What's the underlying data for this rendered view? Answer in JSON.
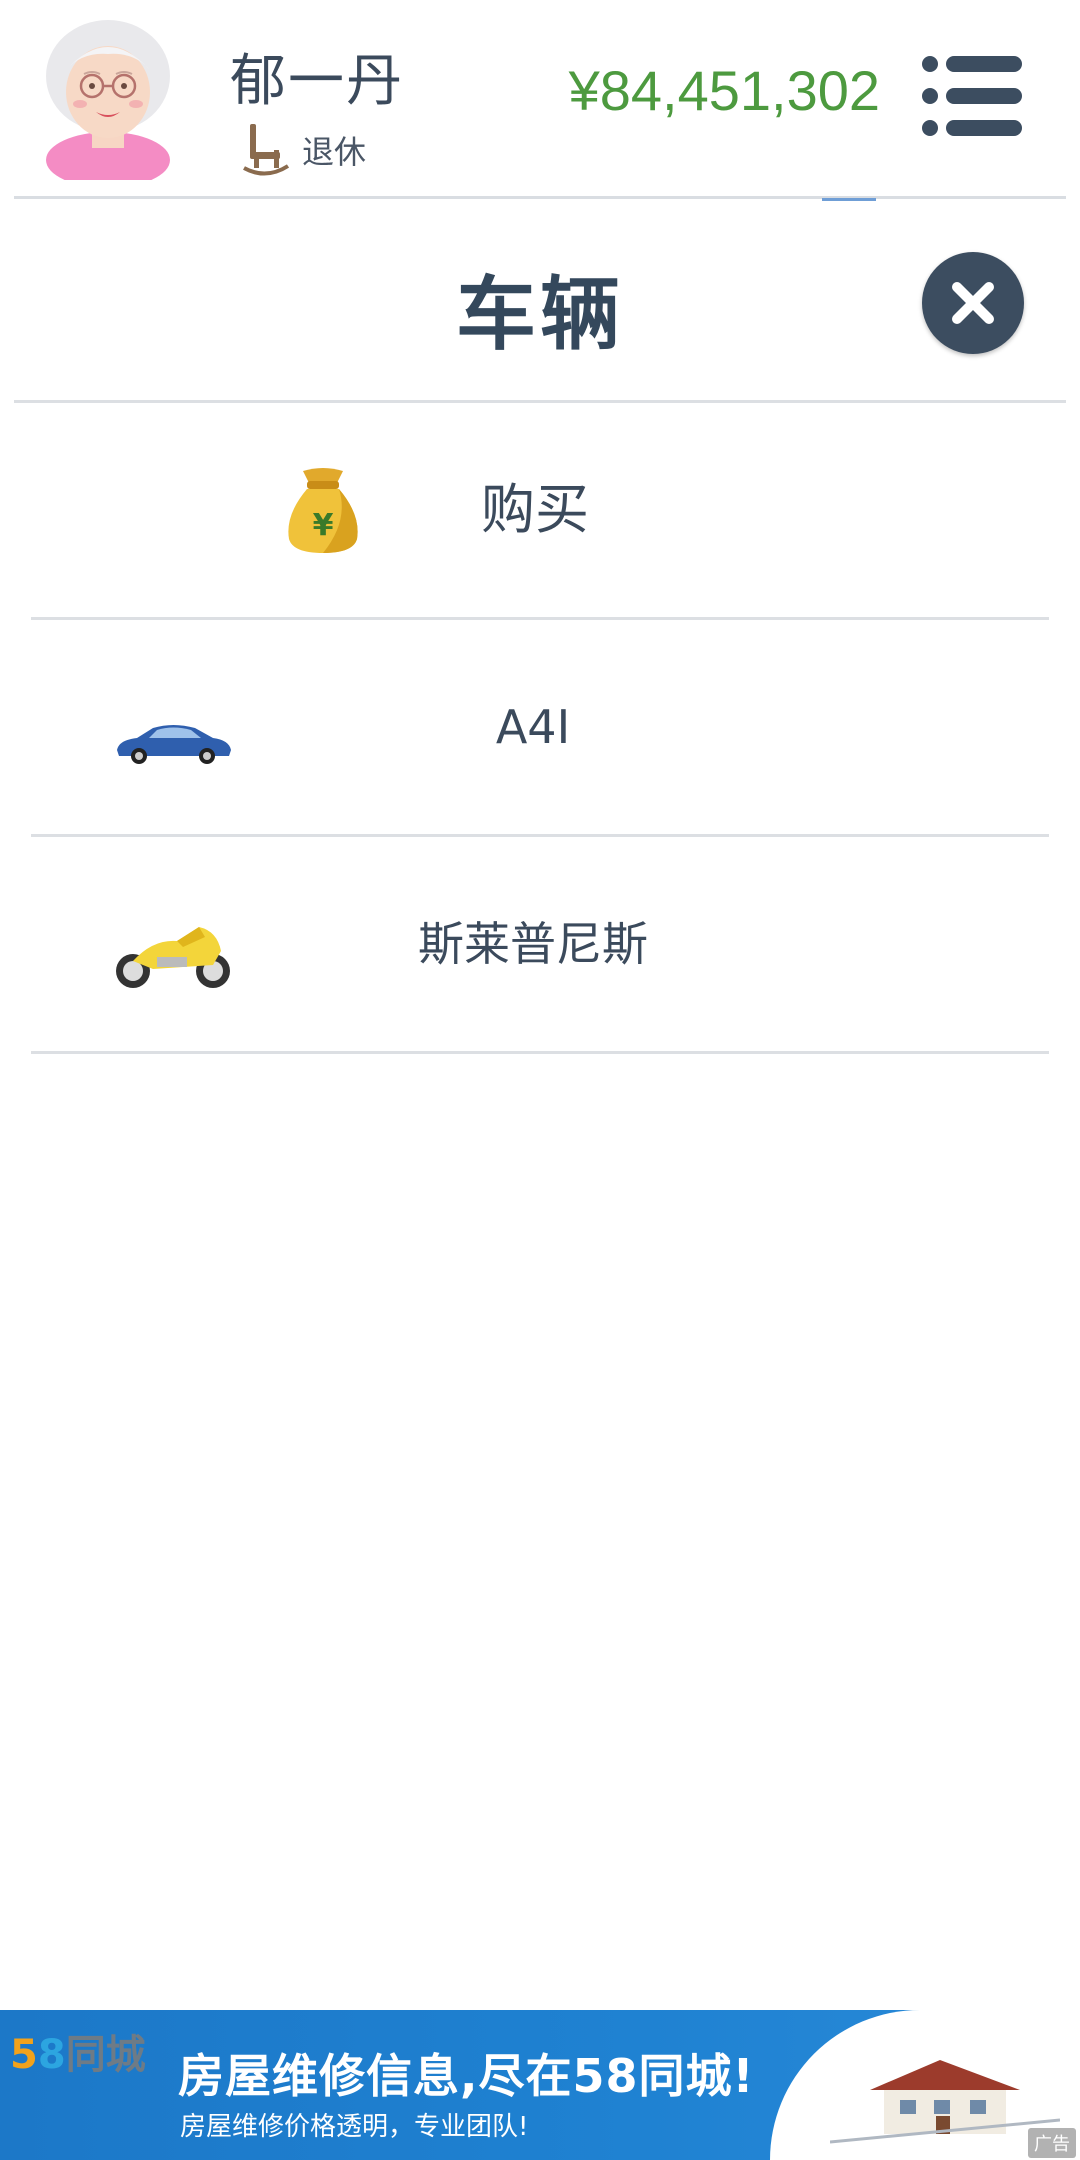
{
  "header": {
    "player_name": "郁一丹",
    "status_label": "退休",
    "money": "¥84,451,302",
    "avatar_icon": "grandma-avatar-icon",
    "status_icon": "rocking-chair-icon",
    "menu_icon": "list-menu-icon"
  },
  "modal": {
    "title": "车辆",
    "close_icon": "close-x-icon"
  },
  "vehicles": {
    "buy": {
      "label": "购买",
      "icon": "money-bag-icon"
    },
    "items": [
      {
        "name": "A4I",
        "icon": "blue-sports-car-icon"
      },
      {
        "name": "斯莱普尼斯",
        "icon": "yellow-motorcycle-icon"
      }
    ]
  },
  "ad": {
    "logo_5": "5",
    "logo_8": "8",
    "logo_text": "同城",
    "headline": "房屋维修信息,尽在58同城!",
    "subtitle": "房屋维修价格透明，专业团队!",
    "tag": "广告"
  },
  "colors": {
    "money": "#4d9a3f",
    "text": "#3b4a5c",
    "close_bg": "#3c4d60",
    "ad_bg": "#1f82d2"
  }
}
